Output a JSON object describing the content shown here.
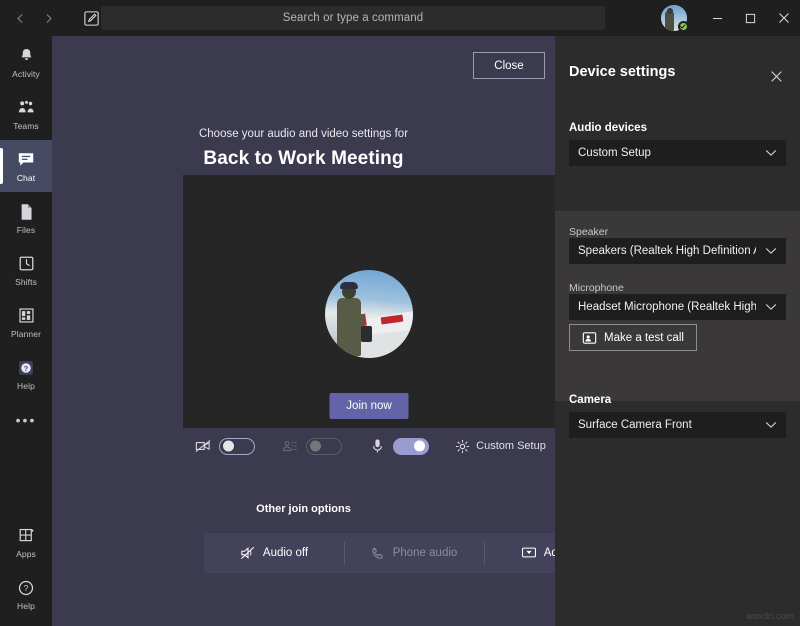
{
  "titlebar": {
    "back_tooltip": "Back",
    "forward_tooltip": "Forward",
    "compose_tooltip": "New chat",
    "search_placeholder": "Search or type a command",
    "minimize_label": "—",
    "maximize_label": "▢",
    "close_label": "✕",
    "presence_status": "Available"
  },
  "rail": {
    "items": [
      {
        "icon": "bell-icon",
        "label": "Activity",
        "active": false
      },
      {
        "icon": "teams-icon",
        "label": "Teams",
        "active": false
      },
      {
        "icon": "chat-icon",
        "label": "Chat",
        "active": true
      },
      {
        "icon": "files-icon",
        "label": "Files",
        "active": false
      },
      {
        "icon": "shifts-icon",
        "label": "Shifts",
        "active": false
      },
      {
        "icon": "planner-icon",
        "label": "Planner",
        "active": false
      },
      {
        "icon": "help-badge-icon",
        "label": "Help",
        "active": false
      }
    ],
    "more_label": "•••",
    "bottom_items": [
      {
        "icon": "apps-icon",
        "label": "Apps"
      },
      {
        "icon": "help-circle-icon",
        "label": "Help"
      }
    ]
  },
  "stage": {
    "close_button": "Close",
    "subtitle": "Choose your audio and video settings for",
    "title": "Back to Work Meeting",
    "join_button": "Join now",
    "controls": {
      "camera": {
        "icon": "camera-off-icon",
        "state": "off",
        "aria": "Camera off"
      },
      "background_blur": {
        "icon": "background-blur-icon",
        "state": "off-disabled",
        "aria": "Background blur"
      },
      "microphone": {
        "icon": "microphone-icon",
        "state": "on",
        "aria": "Microphone on"
      },
      "device_settings": {
        "icon": "gear-icon",
        "label": "Custom Setup"
      }
    },
    "other_join_options_title": "Other join options",
    "other_join_options": [
      {
        "icon": "speaker-off-icon",
        "label": "Audio off",
        "disabled": false
      },
      {
        "icon": "phone-icon",
        "label": "Phone audio",
        "disabled": true
      },
      {
        "icon": "add-room-icon",
        "label": "Add a ro",
        "disabled": false
      }
    ]
  },
  "settings_panel": {
    "title": "Device settings",
    "close_icon_label": "✕",
    "audio_devices": {
      "label": "Audio devices",
      "selected": "Custom Setup"
    },
    "speaker": {
      "label": "Speaker",
      "selected": "Speakers (Realtek High Definition Au..."
    },
    "microphone": {
      "label": "Microphone",
      "selected": "Headset Microphone (Realtek High D..."
    },
    "test_call_button": "Make a test call",
    "camera": {
      "label": "Camera",
      "selected": "Surface Camera Front"
    }
  },
  "watermark": "wsxdn.com",
  "colors": {
    "accent": "#6264a7",
    "accent_light": "#9a9ccf",
    "stage_bg": "#3b3a4f",
    "rail_bg": "#1f1f1f",
    "panel_bg": "#2d2c2c",
    "subpanel_bg": "#3a3838",
    "presence_green": "#92c353"
  }
}
